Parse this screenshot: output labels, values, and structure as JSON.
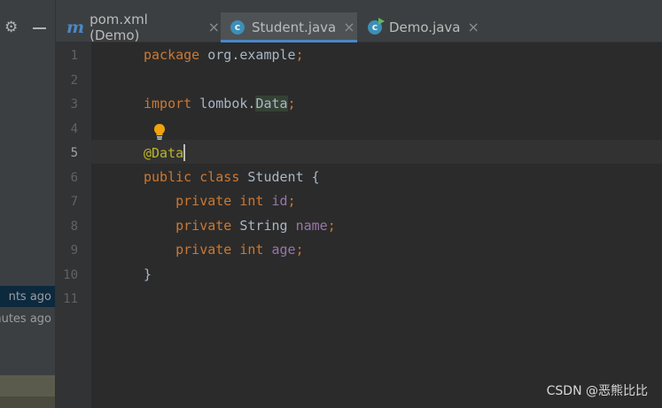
{
  "tabs": [
    {
      "label": "pom.xml (Demo)",
      "icon": "maven-icon",
      "icon_glyph": "m",
      "active": false
    },
    {
      "label": "Student.java",
      "icon": "java-class-icon",
      "icon_glyph": "c",
      "active": true
    },
    {
      "label": "Demo.java",
      "icon": "java-class-runnable-icon",
      "icon_glyph": "c",
      "active": false
    }
  ],
  "tab_close_glyph": "×",
  "sidebar": {
    "history": [
      "nts ago",
      "nutes ago"
    ]
  },
  "editor": {
    "current_line": 5,
    "lines": [
      {
        "num": "1",
        "tokens": [
          {
            "t": "package",
            "c": "kw"
          },
          {
            "t": " org.example",
            "c": "plain"
          },
          {
            "t": ";",
            "c": "kw"
          }
        ]
      },
      {
        "num": "2",
        "tokens": []
      },
      {
        "num": "3",
        "tokens": [
          {
            "t": "import",
            "c": "kw"
          },
          {
            "t": " lombok.",
            "c": "plain"
          },
          {
            "t": "Data",
            "c": "hl"
          },
          {
            "t": ";",
            "c": "kw"
          }
        ]
      },
      {
        "num": "4",
        "tokens": []
      },
      {
        "num": "5",
        "tokens": [
          {
            "t": "@Data",
            "c": "ann"
          }
        ],
        "caret": true
      },
      {
        "num": "6",
        "tokens": [
          {
            "t": "public",
            "c": "kw"
          },
          {
            "t": " ",
            "c": "plain"
          },
          {
            "t": "class",
            "c": "kw"
          },
          {
            "t": " Student {",
            "c": "plain"
          }
        ]
      },
      {
        "num": "7",
        "tokens": [
          {
            "t": "    private",
            "c": "kw"
          },
          {
            "t": " ",
            "c": "plain"
          },
          {
            "t": "int",
            "c": "kw"
          },
          {
            "t": " ",
            "c": "plain"
          },
          {
            "t": "id",
            "c": "fld"
          },
          {
            "t": ";",
            "c": "kw"
          }
        ]
      },
      {
        "num": "8",
        "tokens": [
          {
            "t": "    private",
            "c": "kw"
          },
          {
            "t": " String ",
            "c": "plain"
          },
          {
            "t": "name",
            "c": "fld"
          },
          {
            "t": ";",
            "c": "kw"
          }
        ]
      },
      {
        "num": "9",
        "tokens": [
          {
            "t": "    private",
            "c": "kw"
          },
          {
            "t": " ",
            "c": "plain"
          },
          {
            "t": "int",
            "c": "kw"
          },
          {
            "t": " ",
            "c": "plain"
          },
          {
            "t": "age",
            "c": "fld"
          },
          {
            "t": ";",
            "c": "kw"
          }
        ]
      },
      {
        "num": "10",
        "tokens": [
          {
            "t": "}",
            "c": "plain"
          }
        ]
      },
      {
        "num": "11",
        "tokens": []
      }
    ]
  },
  "watermark": "CSDN @恶熊比比",
  "colors": {
    "keyword": "#cc7832",
    "annotation": "#bbb529",
    "field": "#9876aa",
    "plain": "#a9b7c6",
    "tab_underline": "#4a88c7",
    "bulb": "#f0a30a"
  }
}
